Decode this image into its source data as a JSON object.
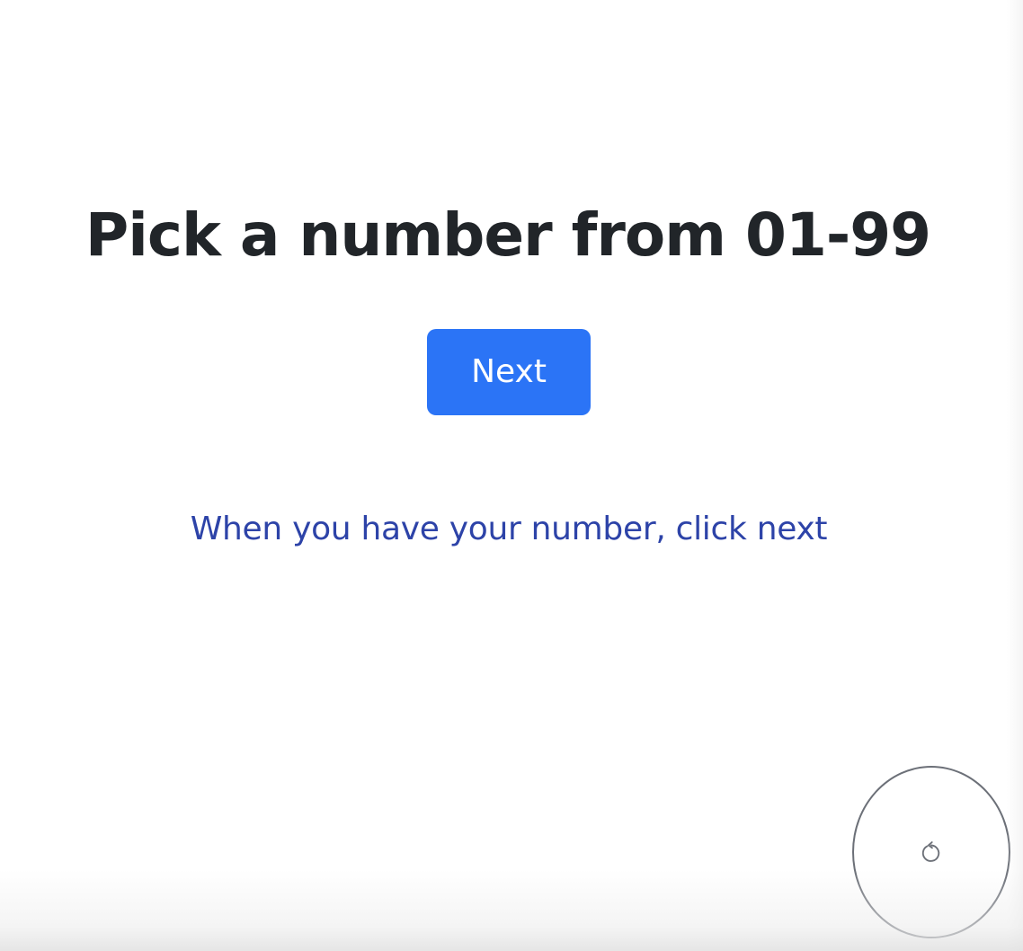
{
  "main": {
    "title": "Pick a number from 01-99",
    "next_label": "Next",
    "hint": "When you have your number, click next"
  },
  "reset": {
    "icon": "reset-icon"
  },
  "colors": {
    "title": "#212529",
    "button_bg": "#2b74f6",
    "button_text": "#ffffff",
    "hint": "#2d43a8",
    "reset_border": "#6c7078"
  }
}
